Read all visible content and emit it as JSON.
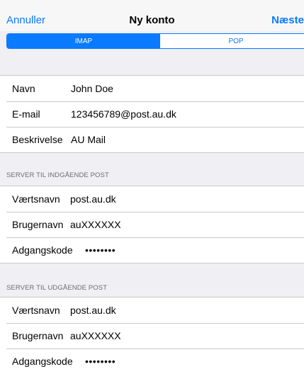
{
  "navbar": {
    "cancel_label": "Annuller",
    "title": "Ny konto",
    "next_label": "Næste"
  },
  "segmented": {
    "options": [
      "IMAP",
      "POP"
    ],
    "selected": "IMAP"
  },
  "account": {
    "rows": [
      {
        "label": "Navn",
        "value": "John Doe"
      },
      {
        "label": "E-mail",
        "value": "123456789@post.au.dk"
      },
      {
        "label": "Beskrivelse",
        "value": "AU Mail"
      }
    ]
  },
  "incoming": {
    "header": "SERVER TIL INDGÅENDE POST",
    "rows": [
      {
        "label": "Værtsnavn",
        "value": "post.au.dk"
      },
      {
        "label": "Brugernavn",
        "value": "auXXXXXX"
      },
      {
        "label": "Adgangskode",
        "value": "••••••••"
      }
    ]
  },
  "outgoing": {
    "header": "SERVER TIL UDGÅENDE POST",
    "rows": [
      {
        "label": "Værtsnavn",
        "value": "post.au.dk"
      },
      {
        "label": "Brugernavn",
        "value": "auXXXXXX"
      },
      {
        "label": "Adgangskode",
        "value": "••••••••"
      }
    ]
  },
  "colors": {
    "accent": "#0a7aff",
    "background": "#efeff4",
    "separator": "#c8c7cc",
    "section_header": "#6d6d72"
  }
}
